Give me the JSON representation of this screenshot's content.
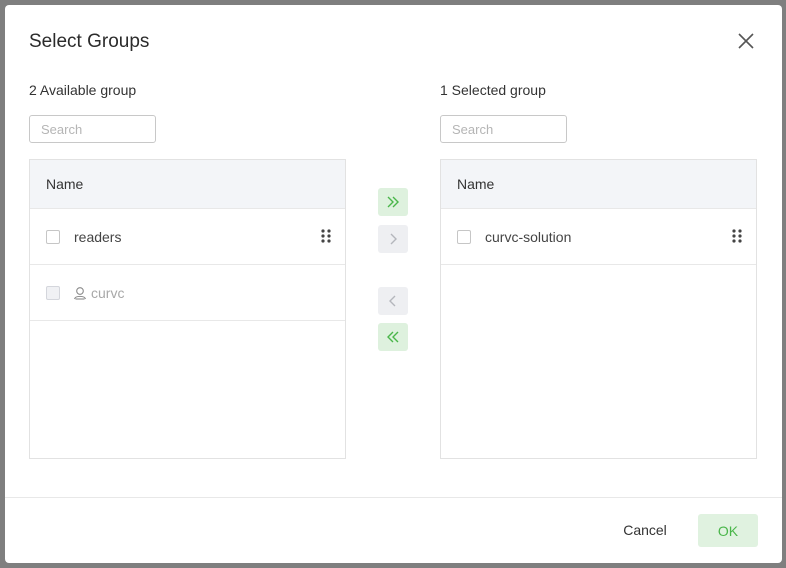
{
  "dialog": {
    "title": "Select Groups",
    "close_icon": "close-icon"
  },
  "available": {
    "heading": "2 Available group",
    "search_placeholder": "Search",
    "column_header": "Name",
    "rows": [
      {
        "label": "readers",
        "disabled": false
      },
      {
        "label": "curvc",
        "disabled": true,
        "icon": "user-icon"
      }
    ]
  },
  "selected": {
    "heading": "1 Selected group",
    "search_placeholder": "Search",
    "column_header": "Name",
    "rows": [
      {
        "label": "curvc-solution",
        "disabled": false
      }
    ]
  },
  "transfer_buttons": {
    "move_all_right": {
      "icon": "double-chevron-right-icon",
      "enabled": true
    },
    "move_right": {
      "icon": "chevron-right-icon",
      "enabled": false
    },
    "move_left": {
      "icon": "chevron-left-icon",
      "enabled": false
    },
    "move_all_left": {
      "icon": "double-chevron-left-icon",
      "enabled": true
    }
  },
  "footer": {
    "cancel_label": "Cancel",
    "ok_label": "OK"
  },
  "colors": {
    "accent": "#4ab64a",
    "accent_bg": "#def1de",
    "overlay": "#7f7f7f"
  }
}
